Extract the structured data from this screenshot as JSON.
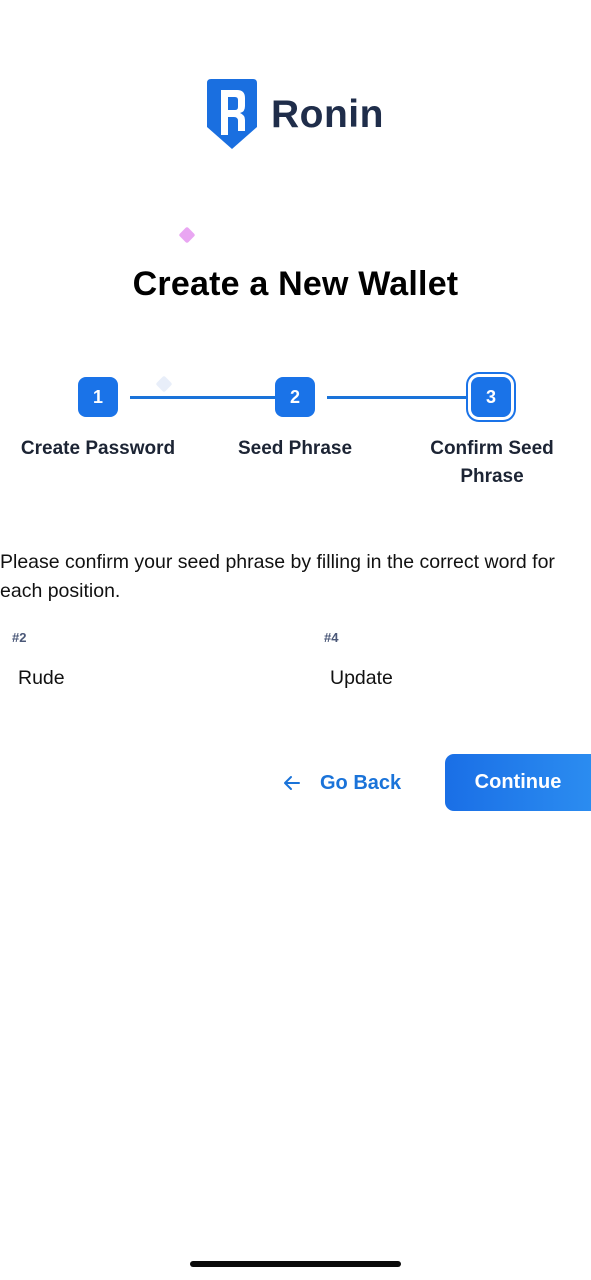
{
  "brand": {
    "name": "Ronin",
    "logo_icon": "ronin-shield-logo",
    "accent_color": "#1a73e8"
  },
  "page": {
    "title": "Create a New Wallet"
  },
  "stepper": {
    "steps": [
      {
        "number": "1",
        "label": "Create Password"
      },
      {
        "number": "2",
        "label": "Seed Phrase"
      },
      {
        "number": "3",
        "label": "Confirm Seed Phrase"
      }
    ],
    "current_step": 3
  },
  "confirm": {
    "instructions": "Please confirm your seed phrase by filling in the correct word for each position.",
    "fields": [
      {
        "position": "#2",
        "value": "Rude"
      },
      {
        "position": "#4",
        "value": "Update"
      }
    ]
  },
  "actions": {
    "back_label": "Go Back",
    "back_icon": "arrow-left-icon",
    "continue_label": "Continue"
  }
}
